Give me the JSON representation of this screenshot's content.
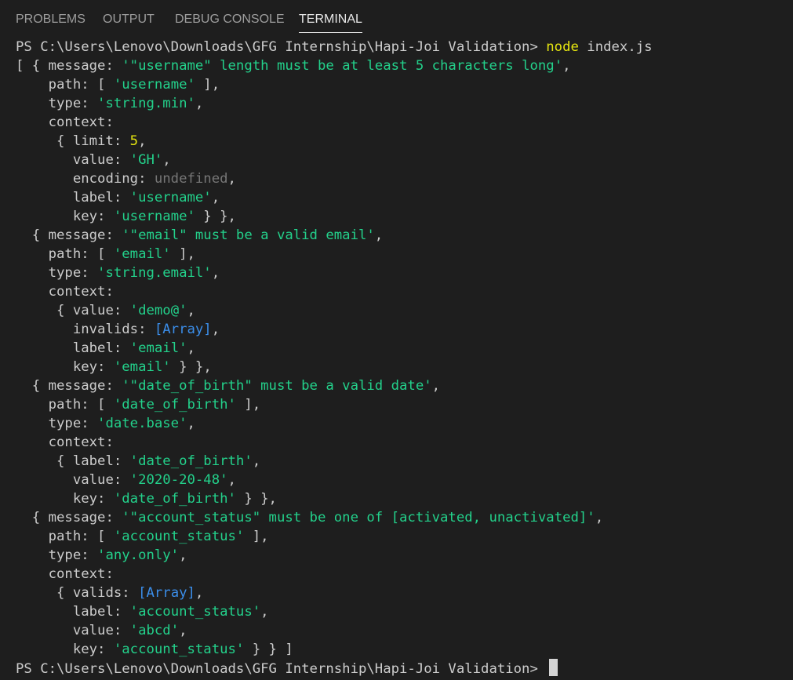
{
  "panel": {
    "tabs": [
      {
        "label": "PROBLEMS",
        "active": false
      },
      {
        "label": "OUTPUT",
        "active": false
      },
      {
        "label": "DEBUG CONSOLE",
        "active": false
      },
      {
        "label": "TERMINAL",
        "active": true
      }
    ]
  },
  "terminal": {
    "prompt": "PS C:\\Users\\Lenovo\\Downloads\\GFG Internship\\Hapi-Joi Validation> ",
    "command": "node",
    "command_args": " index.js",
    "final_prompt": "PS C:\\Users\\Lenovo\\Downloads\\GFG Internship\\Hapi-Joi Validation> ",
    "colors": {
      "string": "#23d18b",
      "number": "#e5e510",
      "undefined": "#767676",
      "array": "#3b8eea",
      "command": "#e5e510",
      "plain": "#cccccc"
    },
    "output_lines": [
      [
        [
          "p",
          "[ { message: "
        ],
        [
          "s",
          "'\"username\" length must be at least 5 characters long'"
        ],
        [
          "p",
          ","
        ]
      ],
      [
        [
          "p",
          "    path: [ "
        ],
        [
          "s",
          "'username'"
        ],
        [
          "p",
          " ],"
        ]
      ],
      [
        [
          "p",
          "    type: "
        ],
        [
          "s",
          "'string.min'"
        ],
        [
          "p",
          ","
        ]
      ],
      [
        [
          "p",
          "    context:"
        ]
      ],
      [
        [
          "p",
          "     { limit: "
        ],
        [
          "n",
          "5"
        ],
        [
          "p",
          ","
        ]
      ],
      [
        [
          "p",
          "       value: "
        ],
        [
          "s",
          "'GH'"
        ],
        [
          "p",
          ","
        ]
      ],
      [
        [
          "p",
          "       encoding: "
        ],
        [
          "u",
          "undefined"
        ],
        [
          "p",
          ","
        ]
      ],
      [
        [
          "p",
          "       label: "
        ],
        [
          "s",
          "'username'"
        ],
        [
          "p",
          ","
        ]
      ],
      [
        [
          "p",
          "       key: "
        ],
        [
          "s",
          "'username'"
        ],
        [
          "p",
          " } },"
        ]
      ],
      [
        [
          "p",
          "  { message: "
        ],
        [
          "s",
          "'\"email\" must be a valid email'"
        ],
        [
          "p",
          ","
        ]
      ],
      [
        [
          "p",
          "    path: [ "
        ],
        [
          "s",
          "'email'"
        ],
        [
          "p",
          " ],"
        ]
      ],
      [
        [
          "p",
          "    type: "
        ],
        [
          "s",
          "'string.email'"
        ],
        [
          "p",
          ","
        ]
      ],
      [
        [
          "p",
          "    context:"
        ]
      ],
      [
        [
          "p",
          "     { value: "
        ],
        [
          "s",
          "'demo@'"
        ],
        [
          "p",
          ","
        ]
      ],
      [
        [
          "p",
          "       invalids: "
        ],
        [
          "a",
          "[Array]"
        ],
        [
          "p",
          ","
        ]
      ],
      [
        [
          "p",
          "       label: "
        ],
        [
          "s",
          "'email'"
        ],
        [
          "p",
          ","
        ]
      ],
      [
        [
          "p",
          "       key: "
        ],
        [
          "s",
          "'email'"
        ],
        [
          "p",
          " } },"
        ]
      ],
      [
        [
          "p",
          "  { message: "
        ],
        [
          "s",
          "'\"date_of_birth\" must be a valid date'"
        ],
        [
          "p",
          ","
        ]
      ],
      [
        [
          "p",
          "    path: [ "
        ],
        [
          "s",
          "'date_of_birth'"
        ],
        [
          "p",
          " ],"
        ]
      ],
      [
        [
          "p",
          "    type: "
        ],
        [
          "s",
          "'date.base'"
        ],
        [
          "p",
          ","
        ]
      ],
      [
        [
          "p",
          "    context:"
        ]
      ],
      [
        [
          "p",
          "     { label: "
        ],
        [
          "s",
          "'date_of_birth'"
        ],
        [
          "p",
          ","
        ]
      ],
      [
        [
          "p",
          "       value: "
        ],
        [
          "s",
          "'2020-20-48'"
        ],
        [
          "p",
          ","
        ]
      ],
      [
        [
          "p",
          "       key: "
        ],
        [
          "s",
          "'date_of_birth'"
        ],
        [
          "p",
          " } },"
        ]
      ],
      [
        [
          "p",
          "  { message: "
        ],
        [
          "s",
          "'\"account_status\" must be one of [activated, unactivated]'"
        ],
        [
          "p",
          ","
        ]
      ],
      [
        [
          "p",
          "    path: [ "
        ],
        [
          "s",
          "'account_status'"
        ],
        [
          "p",
          " ],"
        ]
      ],
      [
        [
          "p",
          "    type: "
        ],
        [
          "s",
          "'any.only'"
        ],
        [
          "p",
          ","
        ]
      ],
      [
        [
          "p",
          "    context:"
        ]
      ],
      [
        [
          "p",
          "     { valids: "
        ],
        [
          "a",
          "[Array]"
        ],
        [
          "p",
          ","
        ]
      ],
      [
        [
          "p",
          "       label: "
        ],
        [
          "s",
          "'account_status'"
        ],
        [
          "p",
          ","
        ]
      ],
      [
        [
          "p",
          "       value: "
        ],
        [
          "s",
          "'abcd'"
        ],
        [
          "p",
          ","
        ]
      ],
      [
        [
          "p",
          "       key: "
        ],
        [
          "s",
          "'account_status'"
        ],
        [
          "p",
          " } } ]"
        ]
      ]
    ]
  }
}
